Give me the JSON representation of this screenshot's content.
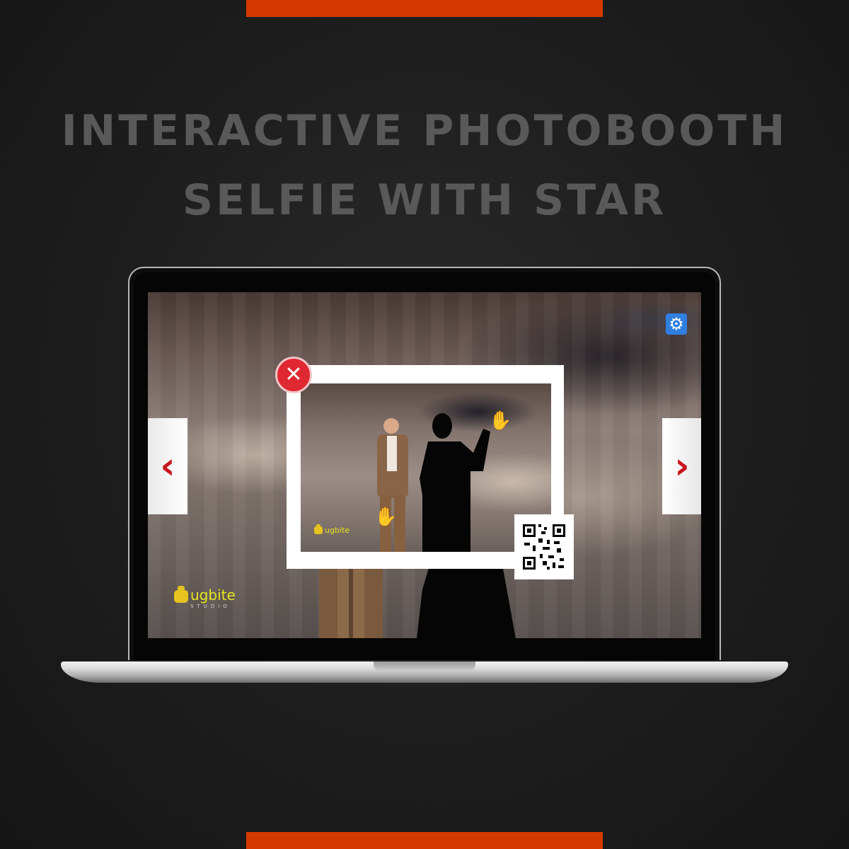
{
  "headline": {
    "line1": "INTERACTIVE PHOTOBOOTH",
    "line2": "SELFIE WITH STAR"
  },
  "booth": {
    "settings_icon": "gear-icon",
    "close_icon": "close-icon",
    "prev_icon": "chevron-left-icon",
    "next_icon": "chevron-right-icon",
    "hand_icon": "hand-icon",
    "qr": "qr-code",
    "logo_word": "ugbite",
    "logo_sub": "STUDIO"
  },
  "colors": {
    "accent": "#d43a00",
    "headline": "#595959",
    "close": "#e02832",
    "settings": "#2f7fe0",
    "nav_arrow": "#c8141e",
    "logo": "#e6e61e"
  }
}
